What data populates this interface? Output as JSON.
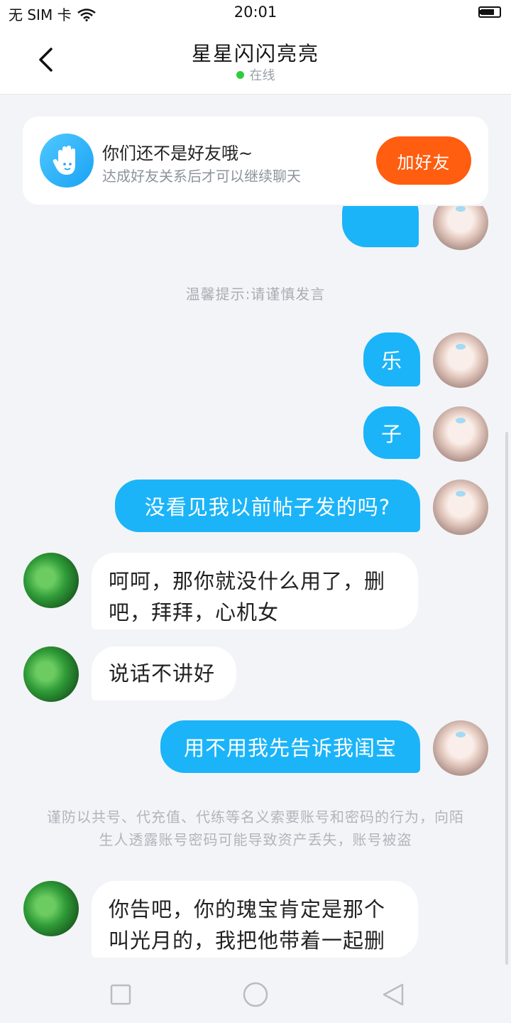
{
  "status_bar": {
    "carrier": "无 SIM 卡",
    "time": "20:01"
  },
  "header": {
    "title": "星星闪闪亮亮",
    "status": "在线"
  },
  "friend_banner": {
    "title": "你们还不是好友哦~",
    "subtitle": "达成好友关系后才可以继续聊天",
    "add_button": "加好友"
  },
  "messages": {
    "tip1": "温馨提示:请谨慎发言",
    "out1": "乐",
    "out2": "子",
    "out3": "没看见我以前帖子发的吗?",
    "in1": "呵呵，那你就没什么用了，删吧，拜拜，心机女",
    "in2": "说话不讲好",
    "out4": "用不用我先告诉我闺宝",
    "warning": "谨防以共号、代充值、代练等名义索要账号和密码的行为，向陌生人透露账号密码可能导致资产丢失，账号被盗",
    "in3": "你告吧，你的瑰宝肯定是那个叫光月的，我把他带着一起删"
  },
  "colors": {
    "bubble_out": "#1bb4f8",
    "add_button": "#ff5d10",
    "online_dot": "#2ecc40"
  },
  "icons": [
    "wifi-icon",
    "battery-icon",
    "back-icon",
    "hand-icon",
    "square-nav-icon",
    "circle-nav-icon",
    "triangle-nav-icon"
  ]
}
